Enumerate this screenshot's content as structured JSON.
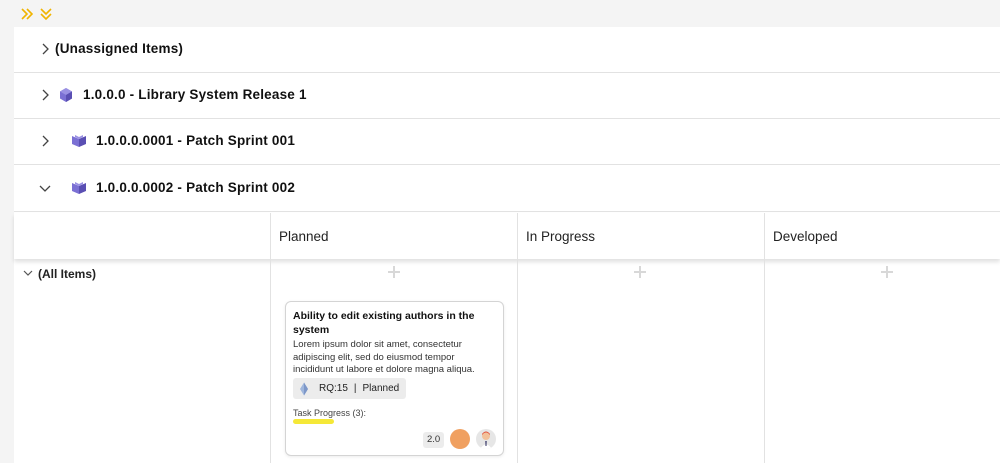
{
  "toolbar": {
    "icons": [
      "double-chevron-right-icon",
      "double-chevron-down-icon"
    ],
    "accent": "#f0b400"
  },
  "releases": [
    {
      "title": "(Unassigned Items)",
      "expanded": false,
      "icon": "none"
    },
    {
      "title": "1.0.0.0 - Library System Release 1",
      "expanded": false,
      "icon": "release-cube-icon"
    },
    {
      "title": "1.0.0.0.0001 - Patch Sprint 001",
      "expanded": false,
      "icon": "sprint-icon"
    },
    {
      "title": "1.0.0.0.0002 - Patch Sprint 002",
      "expanded": true,
      "icon": "sprint-icon"
    }
  ],
  "board": {
    "columns": [
      "Planned",
      "In Progress",
      "Developed"
    ],
    "group_label": "(All Items)",
    "card": {
      "title": "Ability to edit existing authors in the system",
      "description": "Lorem ipsum dolor sit amet, consectetur adipiscing elit, sed do eiusmod tempor incididunt ut labore et dolore magna aliqua.",
      "requirement_id": "RQ:15",
      "separator": "|",
      "status": "Planned",
      "task_progress_label": "Task Progress (3):",
      "task_progress_color": "#f5e837",
      "estimate": "2.0",
      "owner_dot_color": "#f0a060"
    }
  },
  "colors": {
    "release_icon": "#6a5fc1",
    "border": "#e2e2e2"
  }
}
